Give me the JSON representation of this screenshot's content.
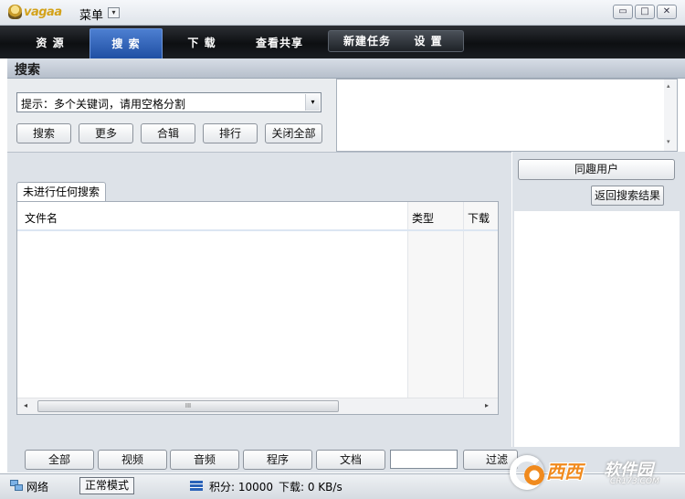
{
  "titlebar": {
    "brand": "vagaa",
    "menu_label": "菜单",
    "menu_dropdown_glyph": "▾",
    "window_buttons": {
      "restore": "▭",
      "maximize": "□",
      "close": "✕"
    }
  },
  "nav": {
    "tabs": [
      {
        "label": "资 源"
      },
      {
        "label": "搜 索",
        "active": true
      },
      {
        "label": "下 载"
      },
      {
        "label": "查看共享"
      }
    ],
    "group": [
      {
        "label": "新建任务"
      },
      {
        "label": "设 置"
      }
    ],
    "active_color": "#2f63bd"
  },
  "section": {
    "title": "搜索"
  },
  "search": {
    "combo_value": "提示：多个关键词，请用空格分割",
    "buttons": [
      "搜索",
      "更多",
      "合辑",
      "排行",
      "关闭全部"
    ]
  },
  "results": {
    "tab_label": "未进行任何搜索",
    "columns": [
      "文件名",
      "类型",
      "下载"
    ],
    "scroll_glyphs": {
      "left": "◂",
      "right": "▸",
      "grip": "III",
      "up": "▴",
      "down": "▾"
    }
  },
  "right_panel": {
    "header_button": "同趣用户",
    "back_button": "返回搜索结果"
  },
  "filters": {
    "buttons": [
      "全部",
      "视频",
      "音频",
      "程序",
      "文档"
    ],
    "filter_button": "过滤",
    "filter_input_value": ""
  },
  "status": {
    "network_label": "网络",
    "mode_button": "正常模式",
    "score_text": "积分: 10000",
    "download_text": "下载: 0 KB/s"
  },
  "watermark": {
    "main": "西西",
    "secondary": "软件园",
    "url": "CR173.COM"
  }
}
